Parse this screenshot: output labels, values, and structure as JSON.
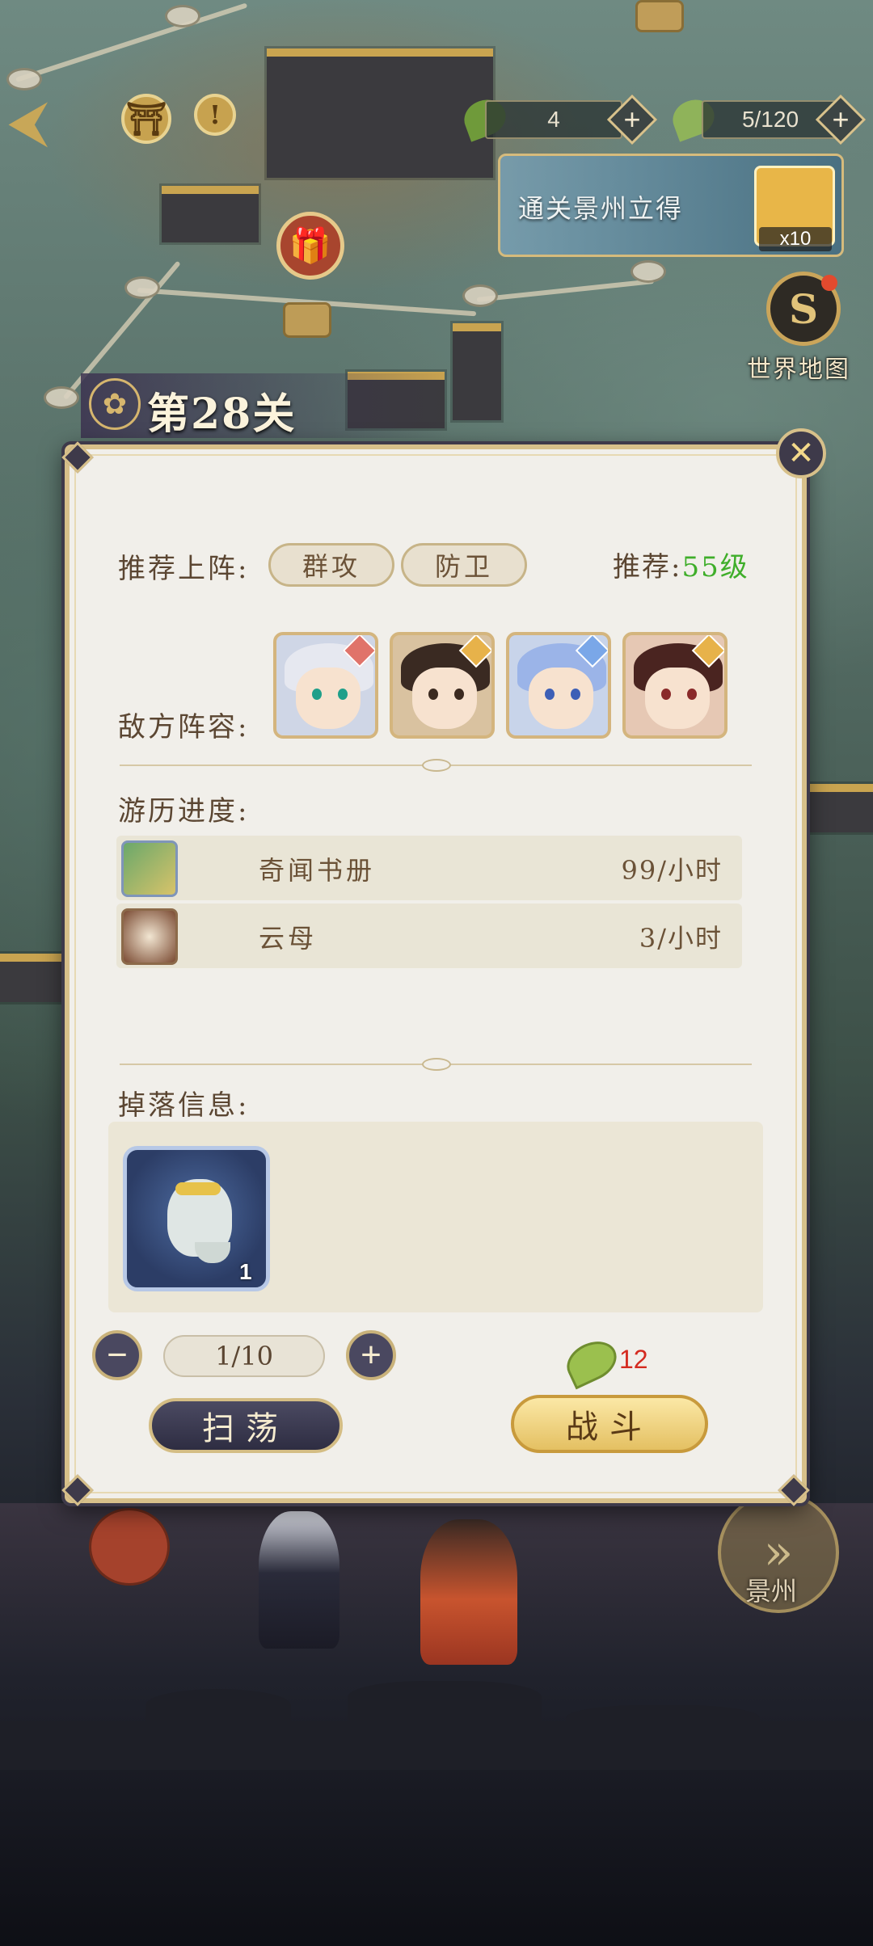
{
  "top_bar": {
    "resource_1_value": "4",
    "resource_2_value": "5/120",
    "plus_symbol": "+"
  },
  "reward_banner": {
    "text": "通关景州立得",
    "item_count": "x10"
  },
  "world_map": {
    "label": "世界地图"
  },
  "stage": {
    "title": "第28关"
  },
  "panel": {
    "close_symbol": "✕",
    "recommended_lineup_label": "推荐上阵:",
    "tags": [
      "群攻",
      "防卫"
    ],
    "recommend_prefix": "推荐:",
    "recommend_level": "55级",
    "enemy_lineup_label": "敌方阵容:",
    "travel_progress_label": "游历进度:",
    "progress": [
      {
        "name": "奇闻书册",
        "rate": "99/小时"
      },
      {
        "name": "云母",
        "rate": "3/小时"
      }
    ],
    "drop_info_label": "掉落信息:",
    "drop_item_count": "1",
    "minus_symbol": "−",
    "plus_symbol": "+",
    "sweep_count": "1/10",
    "stamina_cost": "12",
    "sweep_label": "扫荡",
    "fight_label": "战斗"
  },
  "next_area": {
    "label": "景州"
  },
  "colors": {
    "panel_bg": "#f1efea",
    "panel_border": "#d7c08a",
    "level_green": "#3fae2a",
    "cost_red": "#d42a1f"
  },
  "icons": [
    "back-arrow-icon",
    "hall-icon",
    "alert-icon",
    "gift-icon",
    "leaf-icon",
    "plus-icon",
    "world-map-icon",
    "stage-emblem-icon",
    "close-icon",
    "book-icon",
    "mica-icon",
    "wine-jar-icon",
    "minus-icon",
    "fast-forward-icon"
  ]
}
